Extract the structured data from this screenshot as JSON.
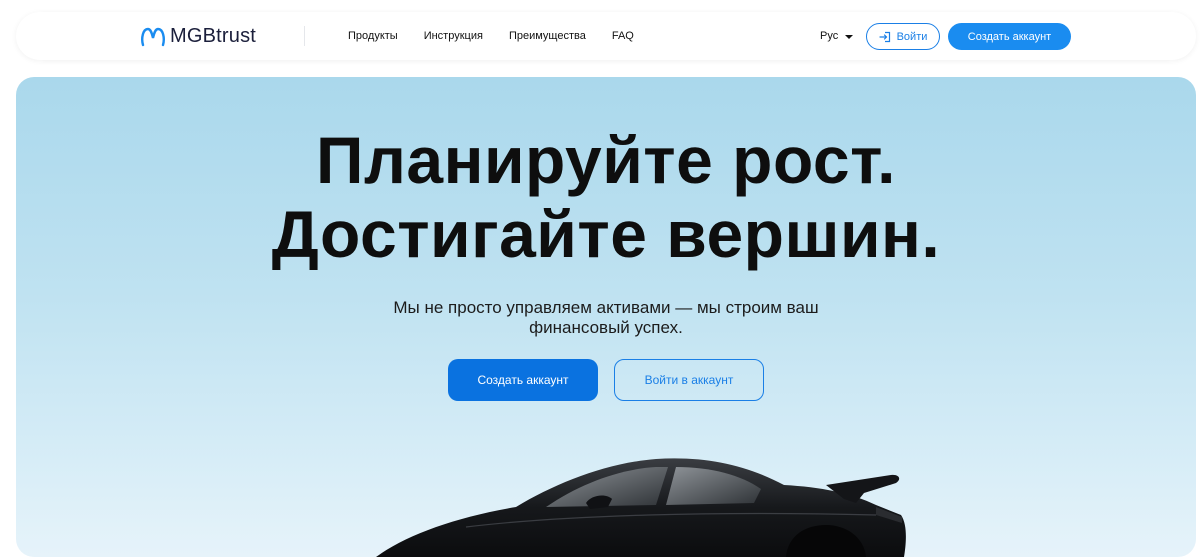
{
  "header": {
    "logo_text": "MGBtrust",
    "nav": [
      {
        "label": "Продукты"
      },
      {
        "label": "Инструкция"
      },
      {
        "label": "Преимущества"
      },
      {
        "label": "FAQ"
      }
    ],
    "language": "Рус",
    "login_label": "Войти",
    "create_account_label": "Создать аккаунт"
  },
  "hero": {
    "title_line1": "Планируйте рост.",
    "title_line2": "Достигайте вершин.",
    "subtitle": "Мы не просто управляем активами — мы строим ваш финансовый успех.",
    "create_account_label": "Создать аккаунт",
    "login_label": "Войти в аккаунт",
    "image": "black-sports-car"
  },
  "colors": {
    "accent": "#1a8cf0",
    "accent_dark": "#0a72e0",
    "hero_bg_top": "#aad8ec",
    "hero_bg_bottom": "#e6f3fa",
    "text": "#0e0e0e"
  }
}
